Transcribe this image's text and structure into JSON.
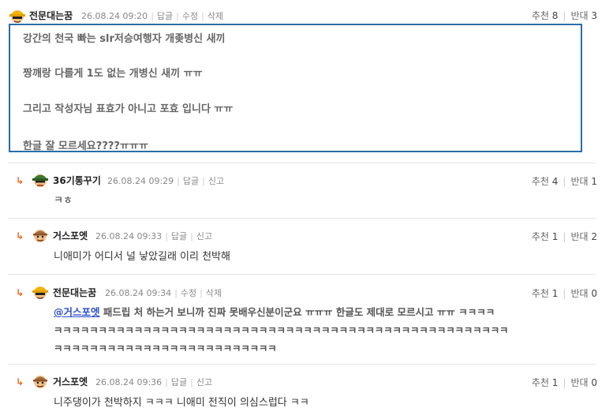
{
  "comments": [
    {
      "nick": "전문대는꿈",
      "date": "26.08.24 09:20",
      "actions": [
        "답글",
        "수정",
        "삭제"
      ],
      "up_label": "추천",
      "up": "8",
      "down_label": "반대",
      "down": "3",
      "lines": [
        "강간의 천국 빠는 slr저승여행자 개좆병신 새끼",
        "짱깨랑 다를게 1도 없는 개병신 새끼 ㅠㅠ",
        "그리고 작성자님 표효가 아니고 포효 입니다 ㅠㅠ",
        "한글 잘 모르세요????ㅠㅠㅠ"
      ]
    },
    {
      "nick": "36기통꾸기",
      "date": "26.08.24 09:29",
      "actions": [
        "답글",
        "신고"
      ],
      "up_label": "추천",
      "up": "4",
      "down_label": "반대",
      "down": "1",
      "text": "ㅋㅎ"
    },
    {
      "nick": "거스포엣",
      "date": "26.08.24 09:33",
      "actions": [
        "답글",
        "신고"
      ],
      "up_label": "추천",
      "up": "1",
      "down_label": "반대",
      "down": "2",
      "text": "니애미가 어디서 널 낳았길래 이리 천박해"
    },
    {
      "nick": "전문대는꿈",
      "date": "26.08.24 09:34",
      "actions": [
        "수정",
        "삭제"
      ],
      "up_label": "추천",
      "up": "1",
      "down_label": "반대",
      "down": "0",
      "mention": "@거스포엣",
      "text1": " 패드립 처 하는거 보니까 진짜 못배우신분이군요 ㅠㅠㅠ 한글도 제대로 모르시고 ㅠㅠ ㅋㅋㅋㅋ",
      "text2": "ㅋㅋㅋㅋㅋㅋㅋㅋㅋㅋㅋㅋㅋㅋㅋㅋㅋㅋㅋㅋㅋㅋㅋㅋㅋㅋㅋㅋㅋㅋㅋㅋㅋㅋㅋㅋㅋㅋㅋㅋㅋㅋㅋㅋㅋㅋㅋㅋㅋㅋㅋ",
      "text3": "ㅋㅋㅋㅋㅋㅋㅋㅋㅋㅋㅋㅋㅋㅋㅋㅋㅋㅋㅋㅋㅋㅋㅋㅋㅋ"
    },
    {
      "nick": "거스포엣",
      "date": "26.08.24 09:36",
      "actions": [
        "답글",
        "신고"
      ],
      "up_label": "추천",
      "up": "1",
      "down_label": "반대",
      "down": "0",
      "text": "니주댕이가 천박하지 ㅋㅋㅋ 니애미 전직이 의심스럽다 ㅋㅋ"
    }
  ],
  "reply_icon": "reply-arrow-icon",
  "accent_color": "#2a6ea8"
}
